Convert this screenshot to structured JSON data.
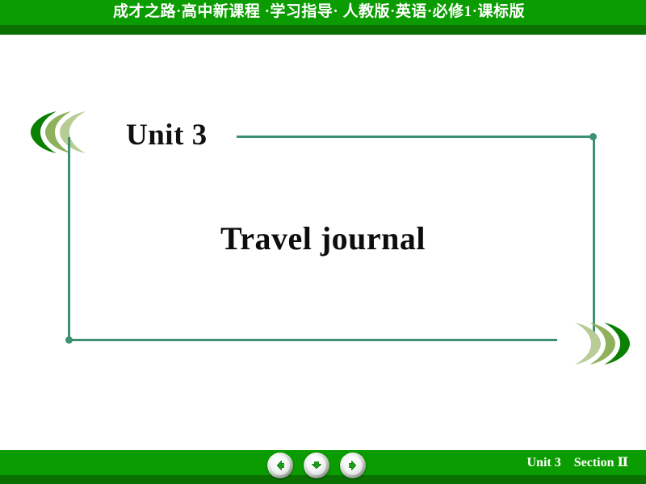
{
  "header": {
    "title": "成才之路·高中新课程 ·学习指导· 人教版·英语·必修1·课标版",
    "band_color": "#0a9c00",
    "shadow_color": "#0a7000",
    "text_color": "#ffffff"
  },
  "main": {
    "unit_heading": "Unit 3",
    "slide_title": "Travel journal",
    "frame_color": "#3d9070",
    "chevron_colors": [
      "#0a8000",
      "#8fb15c",
      "#b8cd96"
    ]
  },
  "footer": {
    "unit_section_label": "Unit 3　Section Ⅱ",
    "band_color": "#0a9c00",
    "shadow_color": "#0a7000",
    "text_color": "#ffffff",
    "buttons": [
      {
        "name": "previous-slide-button",
        "icon": "arrow-left-icon",
        "label": "Previous"
      },
      {
        "name": "down-slide-button",
        "icon": "arrow-down-icon",
        "label": "Down"
      },
      {
        "name": "next-slide-button",
        "icon": "arrow-right-icon",
        "label": "Next"
      }
    ],
    "button_accent_color": "#18a018"
  }
}
